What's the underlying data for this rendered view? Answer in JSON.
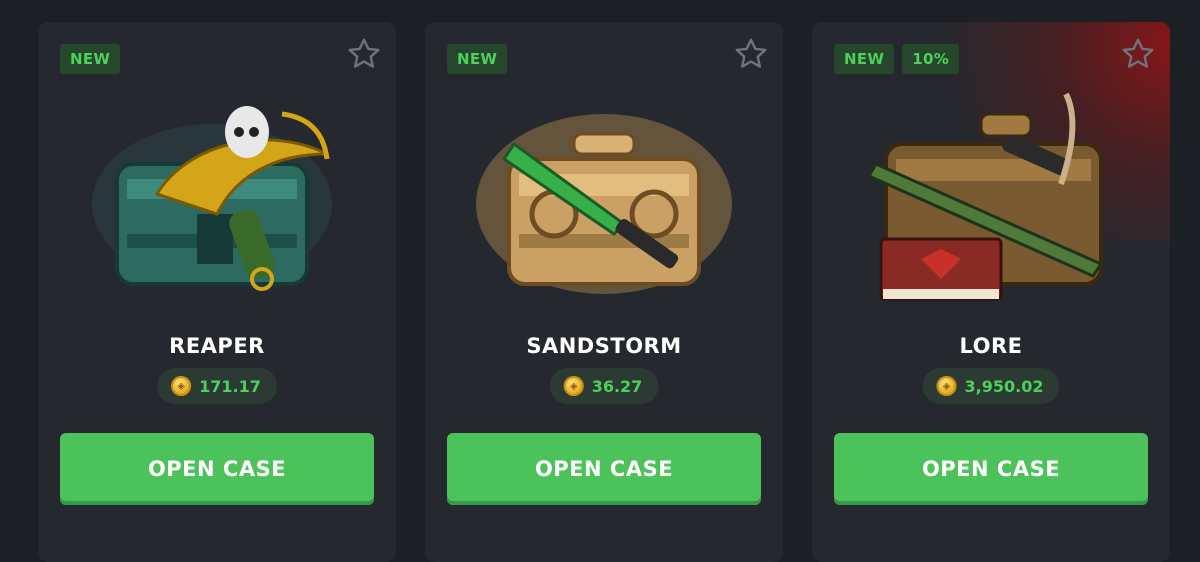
{
  "cards": [
    {
      "badges": [
        "NEW"
      ],
      "name": "REAPER",
      "price": "171.17",
      "button_label": "OPEN CASE",
      "image": "reaper-case-image"
    },
    {
      "badges": [
        "NEW"
      ],
      "name": "SANDSTORM",
      "price": "36.27",
      "button_label": "OPEN CASE",
      "image": "sandstorm-case-image"
    },
    {
      "badges": [
        "NEW",
        "10%"
      ],
      "name": "LORE",
      "price": "3,950.02",
      "button_label": "OPEN CASE",
      "image": "lore-case-image"
    }
  ],
  "icons": {
    "favorite": "star-icon",
    "currency": "coin-icon"
  },
  "colors": {
    "accent": "#4cc35a",
    "badge_text": "#4cd15d",
    "card_bg": "#25282e",
    "page_bg": "#1c1f24"
  }
}
